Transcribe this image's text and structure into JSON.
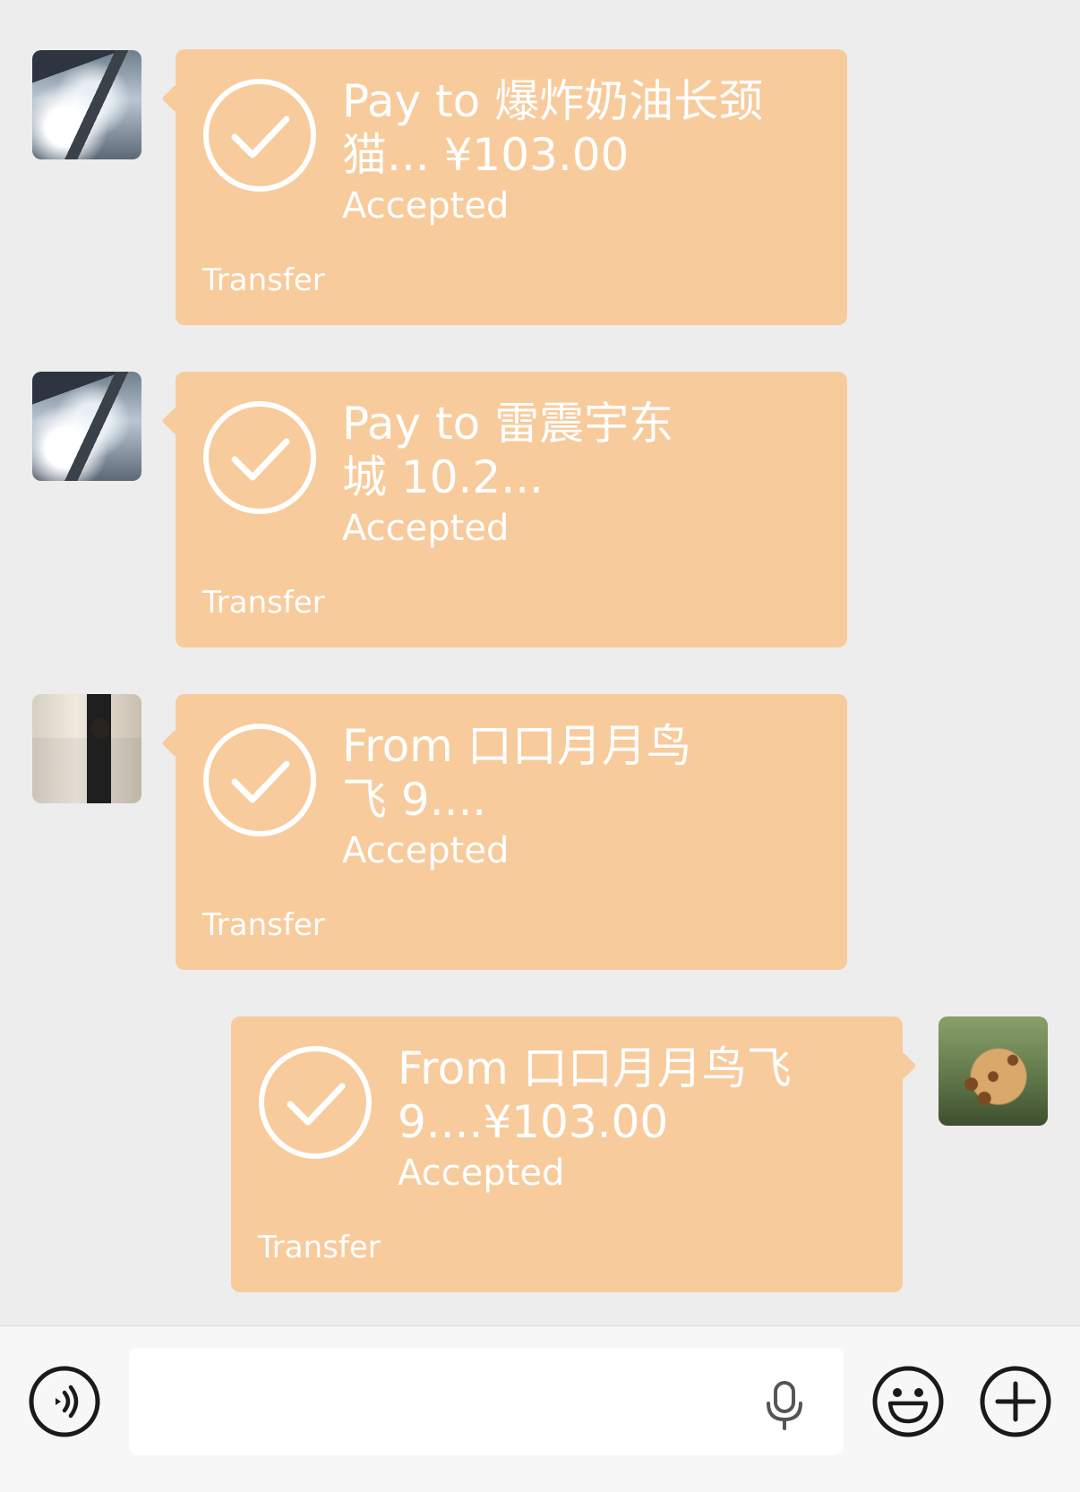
{
  "messages": [
    {
      "side": "left",
      "avatar_icon": "building-reflection-avatar",
      "title": "Pay to 爆炸奶油长颈\n猫... ¥103.00",
      "status": "Accepted",
      "kind": "Transfer"
    },
    {
      "side": "left",
      "avatar_icon": "building-reflection-avatar",
      "title": "Pay to 雷震宇东\n城 10.2...",
      "status": "Accepted",
      "kind": "Transfer"
    },
    {
      "side": "left",
      "avatar_icon": "person-pointing-avatar",
      "title": "From 口口月月鸟\n飞 9....",
      "status": "Accepted",
      "kind": "Transfer"
    },
    {
      "side": "right",
      "avatar_icon": "giraffe-avatar",
      "title": "From 口口月月鸟飞\n 9....¥103.00",
      "status": "Accepted",
      "kind": "Transfer"
    }
  ],
  "input_bar": {
    "text_value": "",
    "icons": [
      "voice-toggle-icon",
      "microphone-icon",
      "emoji-icon",
      "plus-icon"
    ]
  },
  "colors": {
    "background": "#ededed",
    "transfer_card": "#f8cb9c",
    "input_bar": "#f7f7f7"
  }
}
